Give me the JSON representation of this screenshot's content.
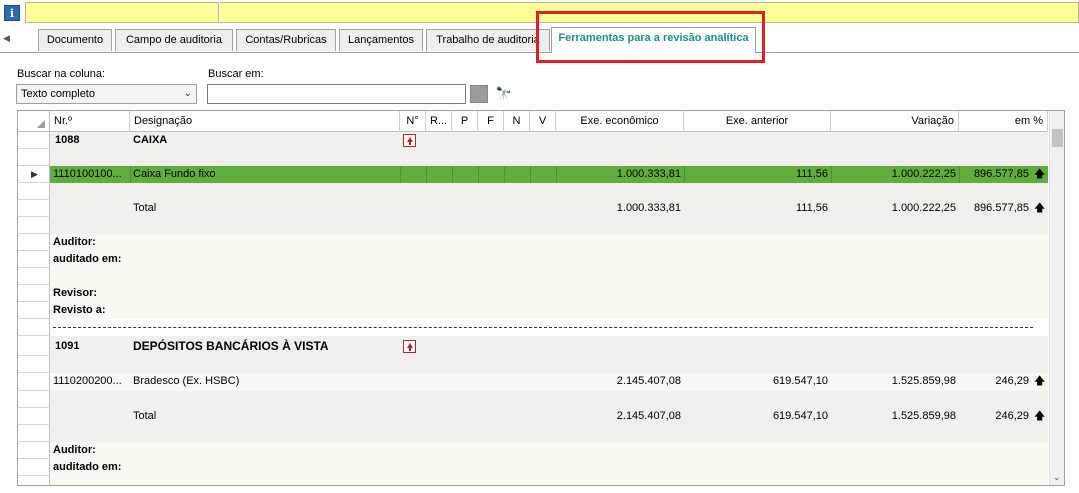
{
  "tabs": [
    {
      "label": "Documento"
    },
    {
      "label": "Campo de auditoria"
    },
    {
      "label": "Contas/Rubricas"
    },
    {
      "label": "Lançamentos"
    },
    {
      "label": "Trabalho de auditoria"
    },
    {
      "label": "Ferramentas para a revisão analítica"
    }
  ],
  "filters": {
    "column_label": "Buscar na coluna:",
    "column_value": "Texto completo",
    "search_label": "Buscar em:",
    "search_value": ""
  },
  "grid": {
    "headers": {
      "nr": "Nr.º",
      "designacao": "Designação",
      "n": "N°",
      "r": "R...",
      "p": "P",
      "f": "F",
      "nn": "N",
      "v": "V",
      "exe_economico": "Exe. econômico",
      "exe_anterior": "Exe. anterior",
      "variacao": "Variação",
      "em_pct": "em %"
    },
    "group1": {
      "code": "1088",
      "name": "CAIXA",
      "row": {
        "nr": "1110100100...",
        "designacao": "Caixa Fundo fixo",
        "exe_economico": "1.000.333,81",
        "exe_anterior": "111,56",
        "variacao": "1.000.222,25",
        "em_pct": "896.577,85"
      },
      "total": {
        "label": "Total",
        "exe_economico": "1.000.333,81",
        "exe_anterior": "111,56",
        "variacao": "1.000.222,25",
        "em_pct": "896.577,85"
      },
      "auditor_label": "Auditor:",
      "auditado_label": "auditado em:",
      "revisor_label": "Revisor:",
      "revisto_label": "Revisto a:"
    },
    "group2": {
      "code": "1091",
      "name": "DEPÓSITOS BANCÁRIOS À VISTA",
      "row": {
        "nr": "1110200200...",
        "designacao": "Bradesco (Ex. HSBC)",
        "exe_economico": "2.145.407,08",
        "exe_anterior": "619.547,10",
        "variacao": "1.525.859,98",
        "em_pct": "246,29"
      },
      "total": {
        "label": "Total",
        "exe_economico": "2.145.407,08",
        "exe_anterior": "619.547,10",
        "variacao": "1.525.859,98",
        "em_pct": "246,29"
      },
      "auditor_label": "Auditor:",
      "auditado_label": "auditado em:"
    }
  },
  "icons": {
    "info": "info-icon",
    "find": "binoculars-icon",
    "upload_doc": "upload-document-icon",
    "trend_up": "arrow-up-icon"
  },
  "colors": {
    "selected_row": "#5fae3c",
    "active_tab_text": "#1f8f8a",
    "highlight": "#e02020",
    "info_bar": "#ffff99"
  }
}
